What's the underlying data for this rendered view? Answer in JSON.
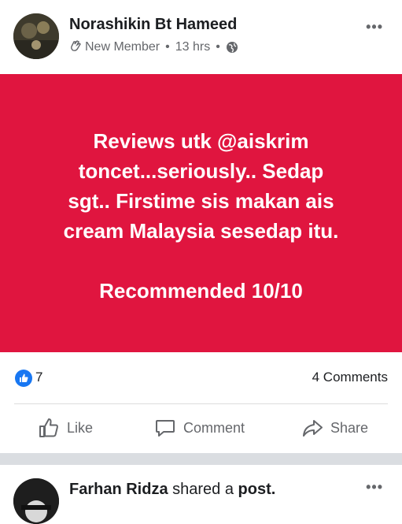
{
  "post": {
    "author": "Norashikin Bt Hameed",
    "member_badge_icon": "wave-hand-icon",
    "member_label": "New Member",
    "time": "13 hrs",
    "privacy_icon": "globe-icon",
    "more_label": "•••",
    "banner_color": "#e0153f",
    "banner_text": "Reviews utk @aiskrim\ntoncet...seriously.. Sedap\nsgt.. Firstime sis makan ais\ncream Malaysia sesedap itu.\n\nRecommended 10/10",
    "reactions_count": "7",
    "comments": "4 Comments",
    "actions": {
      "like": "Like",
      "comment": "Comment",
      "share": "Share"
    }
  },
  "next_post": {
    "author": "Farhan Ridza",
    "verb": "shared a",
    "object": "post.",
    "more_label": "•••"
  }
}
